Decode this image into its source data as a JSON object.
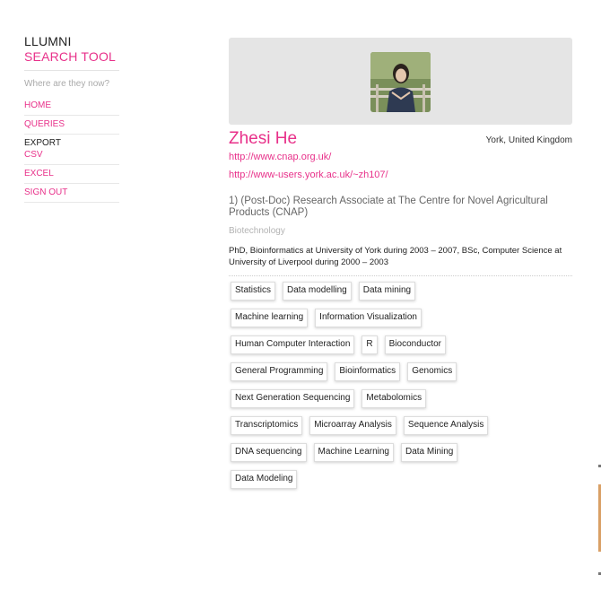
{
  "brand": {
    "line1": "LLUMNI",
    "line2": "SEARCH TOOL"
  },
  "sidebar": {
    "tagline": "Where are they now?",
    "items": [
      {
        "label": "HOME"
      },
      {
        "label": "QUERIES"
      }
    ],
    "export_heading": "EXPORT",
    "export_items": [
      {
        "label": "CSV"
      },
      {
        "label": "EXCEL"
      }
    ],
    "signout": "SIGN OUT"
  },
  "profile": {
    "avatar_icon": "person-photo",
    "name": "Zhesi He",
    "location": "York, United Kingdom",
    "links": [
      "http://www.cnap.org.uk/",
      "http://www-users.york.ac.uk/~zh107/"
    ],
    "position": "1) (Post-Doc) Research Associate at The Centre for Novel Agricultural Products (CNAP)",
    "industry": "Biotechnology",
    "education": "PhD, Bioinformatics at University of York during 2003 – 2007, BSc, Computer Science at University of Liverpool during 2000 – 2003"
  },
  "skills": [
    "Statistics",
    "Data modelling",
    "Data mining",
    "Machine learning",
    "Information Visualization",
    "Human Computer Interaction",
    "R",
    "Bioconductor",
    "General Programming",
    "Bioinformatics",
    "Genomics",
    "Next Generation Sequencing",
    "Metabolomics",
    "Transcriptomics",
    "Microarray Analysis",
    "Sequence Analysis",
    "DNA sequencing",
    "Machine Learning",
    "Data Mining",
    "Data Modeling"
  ],
  "colors": {
    "accent": "#e8318a",
    "banner": "#e5e5e5"
  }
}
